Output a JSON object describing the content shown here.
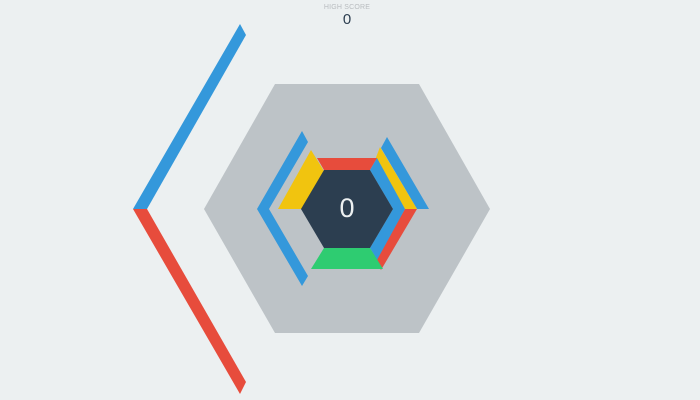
{
  "hud": {
    "high_score_label": "HIGH SCORE",
    "high_score": "0",
    "score": "0"
  },
  "palette": {
    "background": "#ecf0f1",
    "outer_hexagon": "#bdc3c7",
    "center_hexagon": "#2c3e50",
    "red": "#e74c3c",
    "blue": "#3498db",
    "yellow": "#f1c40f",
    "green": "#2ecc71"
  },
  "center_ring": [
    {
      "side": "top",
      "color": "#e74c3c"
    },
    {
      "side": "top-right",
      "color": "#3498db"
    },
    {
      "side": "bottom-right",
      "color": "#3498db"
    },
    {
      "side": "bottom",
      "color": "#2ecc71"
    },
    {
      "side": "bottom-left",
      "color": "#f1c40f"
    },
    {
      "side": "top-left",
      "color": "#f1c40f"
    }
  ]
}
